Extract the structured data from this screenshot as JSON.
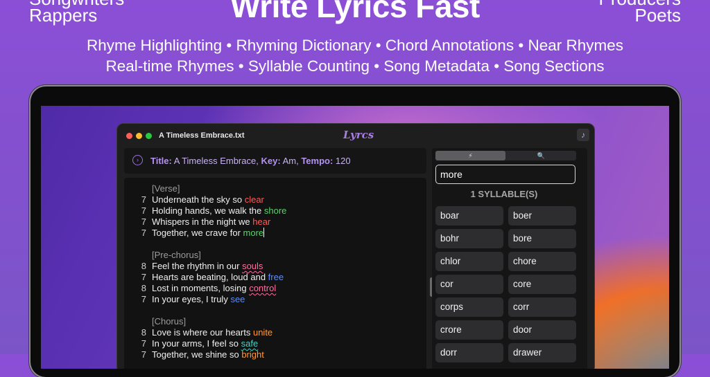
{
  "promo": {
    "left_top": "Songwriters",
    "left_bottom": "Rappers",
    "right_top": "Producers",
    "right_bottom": "Poets",
    "headline": "Write Lyrics Fast",
    "features_row1": "Rhyme Highlighting • Rhyming Dictionary • Chord Annotations • Near Rhymes",
    "features_row2": "Real-time Rhymes • Syllable Counting • Song Metadata • Song Sections"
  },
  "window": {
    "filename": "A Timeless Embrace.txt",
    "logo": "Lyrcs",
    "ear_icon": "ear-icon"
  },
  "metadata": {
    "title_label": "Title:",
    "title_value": "A Timeless Embrace,",
    "key_label": "Key:",
    "key_value": "Am,",
    "tempo_label": "Tempo:",
    "tempo_value": "120"
  },
  "editor": {
    "verse_header": "[Verse]",
    "prechorus_header": "[Pre-chorus]",
    "chorus_header": "[Chorus]",
    "lines": [
      {
        "count": "7",
        "text": "Underneath the sky so ",
        "rhyme": "clear"
      },
      {
        "count": "7",
        "text": "Holding hands, we walk the ",
        "rhyme": "shore"
      },
      {
        "count": "7",
        "text": "Whispers in the night we ",
        "rhyme": "hear"
      },
      {
        "count": "7",
        "text": "Together, we crave for ",
        "rhyme": "more"
      },
      {
        "count": "8",
        "text": "Feel the rhythm in our ",
        "rhyme": "souls"
      },
      {
        "count": "7",
        "text": "Hearts are beating, loud and ",
        "rhyme": "free"
      },
      {
        "count": "8",
        "text": "Lost in moments, losing ",
        "rhyme": "control"
      },
      {
        "count": "7",
        "text": "In your eyes, I truly ",
        "rhyme": "see"
      },
      {
        "count": "8",
        "text": "Love is where our hearts ",
        "rhyme": "unite"
      },
      {
        "count": "7",
        "text": "In your arms, I feel so ",
        "rhyme": "safe"
      },
      {
        "count": "7",
        "text": "Together, we shine so ",
        "rhyme": "bright"
      }
    ]
  },
  "sidebar": {
    "tab_lightning": "⚡",
    "tab_search": "🔍",
    "search_value": "more",
    "syllable_header": "1 SYLLABLE(S)",
    "words": [
      "boar",
      "boer",
      "bohr",
      "bore",
      "chlor",
      "chore",
      "cor",
      "core",
      "corps",
      "corr",
      "crore",
      "door",
      "dorr",
      "drawer"
    ]
  },
  "colors": {
    "background": "#8b4fd6",
    "accent": "#b493ef",
    "rhyme_red": "#ff5a5a",
    "rhyme_green": "#5bd36a",
    "rhyme_pink": "#ff6fa0",
    "rhyme_blue": "#5b8dff",
    "rhyme_orange": "#ff9b3a",
    "rhyme_teal": "#4bd1c3"
  }
}
